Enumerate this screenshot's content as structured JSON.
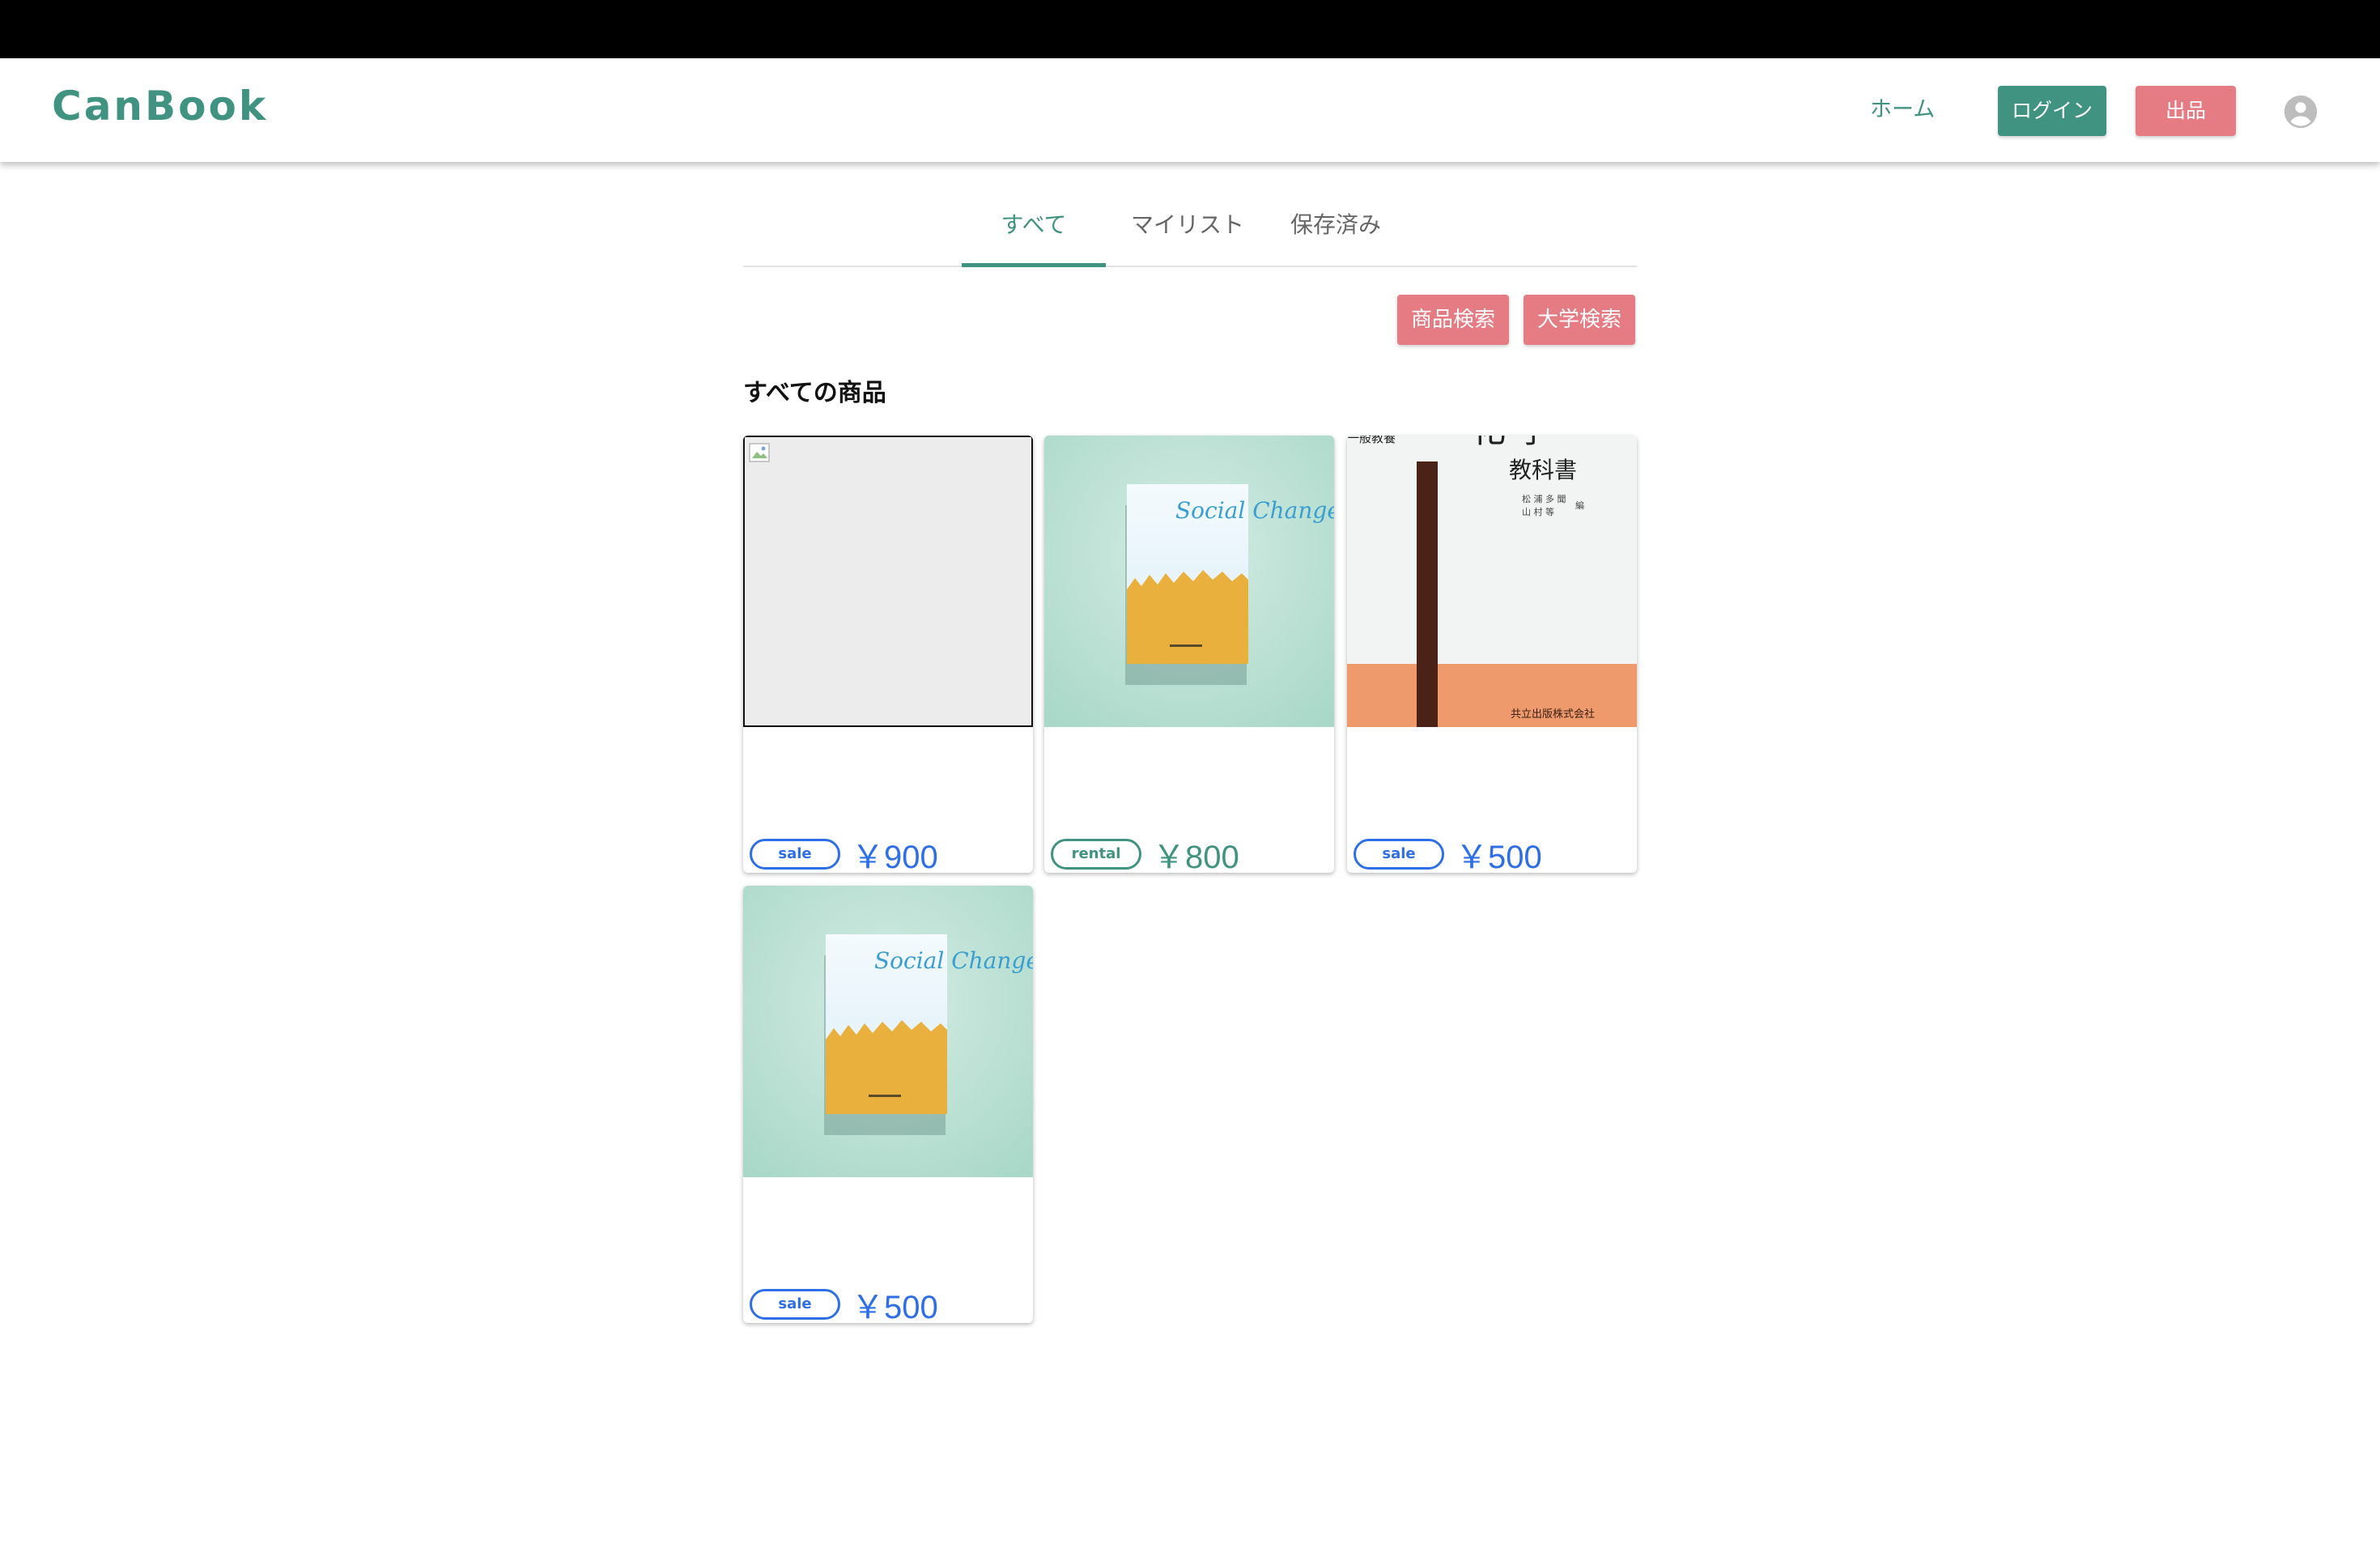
{
  "header": {
    "logo": "CanBook",
    "nav_home": "ホーム",
    "login_button": "ログイン",
    "sell_button": "出品"
  },
  "tabs": [
    {
      "label": "すべて",
      "active": true
    },
    {
      "label": "マイリスト",
      "active": false
    },
    {
      "label": "保存済み",
      "active": false
    }
  ],
  "search": {
    "product_search": "商品検索",
    "university_search": "大学検索"
  },
  "section_title": "すべての商品",
  "products": [
    {
      "type": "sale",
      "price": "￥900",
      "image": "broken-image"
    },
    {
      "type": "rental",
      "price": "￥800",
      "image": "social-change-book",
      "cover_title": "Social Change"
    },
    {
      "type": "sale",
      "price": "￥500",
      "image": "chemistry-textbook",
      "cover_title_top": "化 学",
      "cover_title": "教科書",
      "cover_authors": [
        "松 浦 多 聞",
        "山 村 等"
      ],
      "cover_editor": "編",
      "cover_series": "一般教養",
      "cover_publisher": "共立出版株式会社"
    },
    {
      "type": "sale",
      "price": "￥500",
      "image": "social-change-book",
      "cover_title": "Social Change"
    }
  ],
  "colors": {
    "brand_green": "#3f9380",
    "accent_pink": "#e57b83",
    "sale_blue": "#2e6ee6"
  }
}
